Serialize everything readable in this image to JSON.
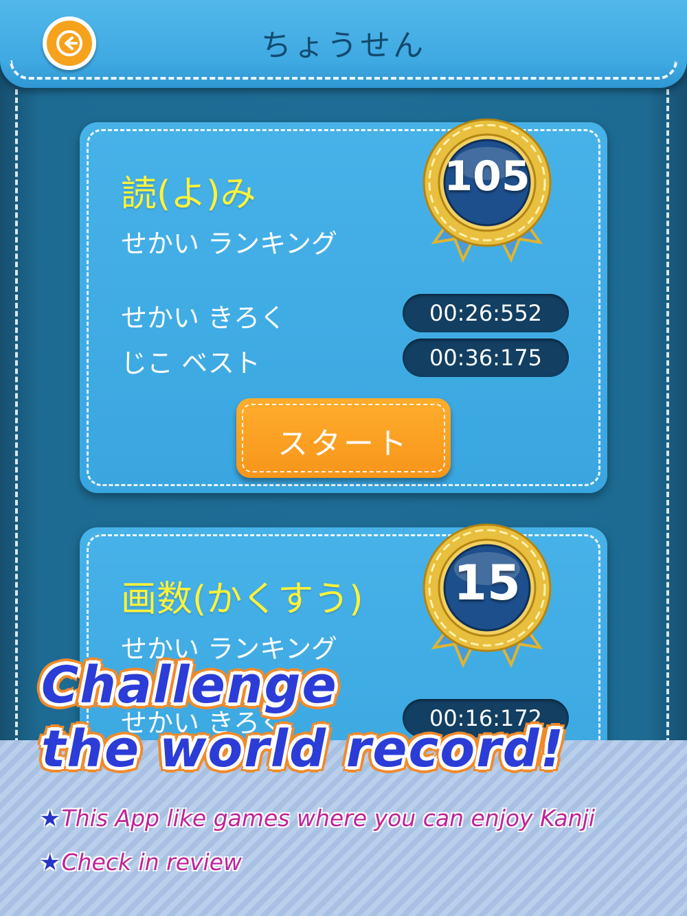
{
  "header": {
    "title": "ちょうせん"
  },
  "cards": [
    {
      "mode_title": "読(よ)み",
      "ranking_label": "せかい ランキング",
      "rank": "105",
      "world_record_label": "せかい きろく",
      "world_record_time": "00:26:552",
      "personal_best_label": "じこ ベスト",
      "personal_best_time": "00:36:175",
      "start_label": "スタート"
    },
    {
      "mode_title": "画数(かくすう)",
      "ranking_label": "せかい ランキング",
      "rank": "15",
      "world_record_label": "せかい きろく",
      "world_record_time": "00:16:172"
    }
  ],
  "promo": {
    "headline_line1": "Challenge",
    "headline_line2": "the world record!",
    "bullet_star": "★",
    "bullet1": "This App like games where you can enjoy Kanji",
    "bullet2": "Check in review"
  },
  "colors": {
    "header_blue": "#3fa9e2",
    "card_blue": "#3aa6e0",
    "accent_orange": "#f7951a",
    "title_yellow": "#fff23a",
    "pill_navy": "#123f62",
    "headline_blue": "#2b3dd6",
    "bullet_magenta": "#c0239a"
  }
}
